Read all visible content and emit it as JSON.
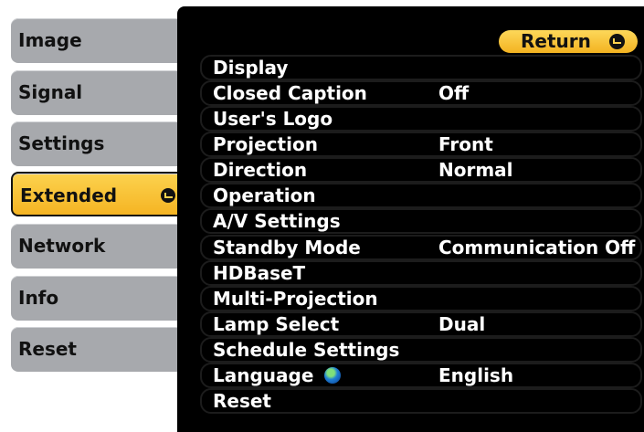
{
  "sidebar": {
    "tabs": [
      {
        "label": "Image",
        "active": false
      },
      {
        "label": "Signal",
        "active": false
      },
      {
        "label": "Settings",
        "active": false
      },
      {
        "label": "Extended",
        "active": true
      },
      {
        "label": "Network",
        "active": false
      },
      {
        "label": "Info",
        "active": false
      },
      {
        "label": "Reset",
        "active": false
      }
    ]
  },
  "header": {
    "return_label": "Return"
  },
  "menu": {
    "items": [
      {
        "label": "Display",
        "value": ""
      },
      {
        "label": "Closed Caption",
        "value": "Off"
      },
      {
        "label": "User's Logo",
        "value": ""
      },
      {
        "label": "Projection",
        "value": "Front"
      },
      {
        "label": "Direction",
        "value": "Normal"
      },
      {
        "label": "Operation",
        "value": ""
      },
      {
        "label": "A/V Settings",
        "value": ""
      },
      {
        "label": "Standby Mode",
        "value": "Communication Off"
      },
      {
        "label": "HDBaseT",
        "value": ""
      },
      {
        "label": "Multi-Projection",
        "value": ""
      },
      {
        "label": "Lamp Select",
        "value": "Dual"
      },
      {
        "label": "Schedule Settings",
        "value": ""
      },
      {
        "label": "Language",
        "value": "English",
        "icon": "globe-icon"
      },
      {
        "label": "Reset",
        "value": ""
      }
    ]
  },
  "colors": {
    "accent": "#f7c032",
    "tab_inactive": "#a7a9ad",
    "panel": "#000000"
  }
}
